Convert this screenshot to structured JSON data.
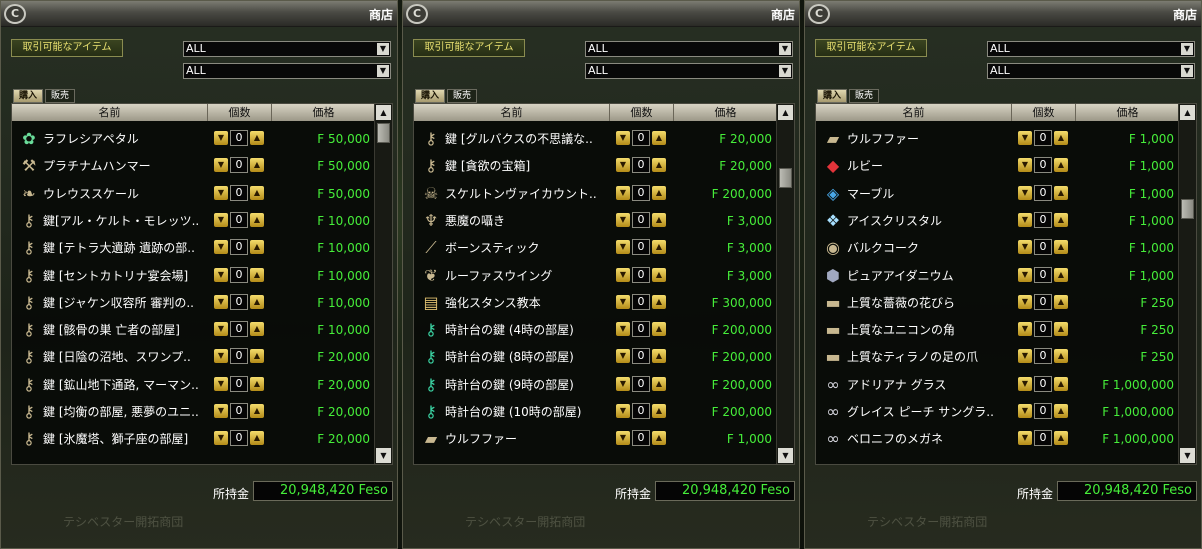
{
  "panels": [
    {
      "title": "商店",
      "filter_label": "取引可能なアイテム",
      "select1": "ALL",
      "select2": "ALL",
      "tabs": [
        "購入",
        "販売"
      ],
      "headers": [
        "名前",
        "個数",
        "価格"
      ],
      "items": [
        {
          "name": "ラフレシアペタル",
          "qty": "0",
          "price": "F 50,000",
          "icon": "flower-icon"
        },
        {
          "name": "プラチナムハンマー",
          "qty": "0",
          "price": "F 50,000",
          "icon": "hammer-icon"
        },
        {
          "name": "ウレウススケール",
          "qty": "0",
          "price": "F 50,000",
          "icon": "scale-icon"
        },
        {
          "name": "鍵[アル・ケルト・モレッツ..",
          "qty": "0",
          "price": "F 10,000",
          "icon": "key-icon"
        },
        {
          "name": "鍵 [テトラ大遺跡 遺跡の部..",
          "qty": "0",
          "price": "F 10,000",
          "icon": "key-icon"
        },
        {
          "name": "鍵 [セントカトリナ宴会場]",
          "qty": "0",
          "price": "F 10,000",
          "icon": "key-icon"
        },
        {
          "name": "鍵 [ジャケン収容所 審判の..",
          "qty": "0",
          "price": "F 10,000",
          "icon": "key-icon"
        },
        {
          "name": "鍵 [骸骨の巣 亡者の部屋]",
          "qty": "0",
          "price": "F 10,000",
          "icon": "key-icon"
        },
        {
          "name": "鍵 [日陰の沼地、スワンプ..",
          "qty": "0",
          "price": "F 20,000",
          "icon": "key-icon"
        },
        {
          "name": "鍵 [鉱山地下通路, マーマン..",
          "qty": "0",
          "price": "F 20,000",
          "icon": "key-icon"
        },
        {
          "name": "鍵 [均衡の部屋, 悪夢のユニ..",
          "qty": "0",
          "price": "F 20,000",
          "icon": "key-icon"
        },
        {
          "name": "鍵 [氷魔塔、獅子座の部屋]",
          "qty": "0",
          "price": "F 20,000",
          "icon": "key-icon"
        }
      ],
      "money_label": "所持金",
      "money": "20,948,420 Feso",
      "shop_name": "テシベスター開拓商団"
    },
    {
      "title": "商店",
      "filter_label": "取引可能なアイテム",
      "select1": "ALL",
      "select2": "ALL",
      "tabs": [
        "購入",
        "販売"
      ],
      "headers": [
        "名前",
        "個数",
        "価格"
      ],
      "items": [
        {
          "name": "鍵 [グルバクスの不思議な..",
          "qty": "0",
          "price": "F 20,000",
          "icon": "key-icon"
        },
        {
          "name": "鍵 [貪欲の宝箱]",
          "qty": "0",
          "price": "F 20,000",
          "icon": "key-icon"
        },
        {
          "name": "スケルトンヴァイカウント..",
          "qty": "0",
          "price": "F 200,000",
          "icon": "skull-icon"
        },
        {
          "name": "悪魔の囁き",
          "qty": "0",
          "price": "F 3,000",
          "icon": "demon-icon"
        },
        {
          "name": "ボーンスティック",
          "qty": "0",
          "price": "F 3,000",
          "icon": "bone-icon"
        },
        {
          "name": "ルーファスウイング",
          "qty": "0",
          "price": "F 3,000",
          "icon": "wing-icon"
        },
        {
          "name": "強化スタンス教本",
          "qty": "0",
          "price": "F 300,000",
          "icon": "book-icon"
        },
        {
          "name": "時計台の鍵 (4時の部屋)",
          "qty": "0",
          "price": "F 200,000",
          "icon": "clock-key-icon"
        },
        {
          "name": "時計台の鍵 (8時の部屋)",
          "qty": "0",
          "price": "F 200,000",
          "icon": "clock-key-icon"
        },
        {
          "name": "時計台の鍵 (9時の部屋)",
          "qty": "0",
          "price": "F 200,000",
          "icon": "clock-key-icon"
        },
        {
          "name": "時計台の鍵 (10時の部屋)",
          "qty": "0",
          "price": "F 200,000",
          "icon": "clock-key-icon"
        },
        {
          "name": "ウルフファー",
          "qty": "0",
          "price": "F 1,000",
          "icon": "fur-icon"
        }
      ],
      "money_label": "所持金",
      "money": "20,948,420 Feso",
      "shop_name": "テシベスター開拓商団"
    },
    {
      "title": "商店",
      "filter_label": "取引可能なアイテム",
      "select1": "ALL",
      "select2": "ALL",
      "tabs": [
        "購入",
        "販売"
      ],
      "headers": [
        "名前",
        "個数",
        "価格"
      ],
      "items": [
        {
          "name": "ウルフファー",
          "qty": "0",
          "price": "F 1,000",
          "icon": "fur-icon"
        },
        {
          "name": "ルビー",
          "qty": "0",
          "price": "F 1,000",
          "icon": "ruby-icon"
        },
        {
          "name": "マーブル",
          "qty": "0",
          "price": "F 1,000",
          "icon": "marble-icon"
        },
        {
          "name": "アイスクリスタル",
          "qty": "0",
          "price": "F 1,000",
          "icon": "crystal-icon"
        },
        {
          "name": "バルクコーク",
          "qty": "0",
          "price": "F 1,000",
          "icon": "coke-icon"
        },
        {
          "name": "ピュアアイダニウム",
          "qty": "0",
          "price": "F 1,000",
          "icon": "ore-icon"
        },
        {
          "name": "上質な薔薇の花びら",
          "qty": "0",
          "price": "F 250",
          "icon": "cloth-icon"
        },
        {
          "name": "上質なユニコンの角",
          "qty": "0",
          "price": "F 250",
          "icon": "cloth-icon"
        },
        {
          "name": "上質なティラノの足の爪",
          "qty": "0",
          "price": "F 250",
          "icon": "cloth-icon"
        },
        {
          "name": "アドリアナ グラス",
          "qty": "0",
          "price": "F 1,000,000",
          "icon": "glasses-icon"
        },
        {
          "name": "グレイス ピーチ サングラ..",
          "qty": "0",
          "price": "F 1,000,000",
          "icon": "glasses-icon"
        },
        {
          "name": "ベロニフのメガネ",
          "qty": "0",
          "price": "F 1,000,000",
          "icon": "glasses-icon"
        }
      ],
      "money_label": "所持金",
      "money": "20,948,420 Feso",
      "shop_name": "テシベスター開拓商団"
    }
  ],
  "scroll_positions": [
    0.0,
    0.15,
    0.25
  ],
  "colors": {
    "price": "#46ee3a",
    "money": "#46ee3a",
    "filter_label": "#e8e070"
  }
}
